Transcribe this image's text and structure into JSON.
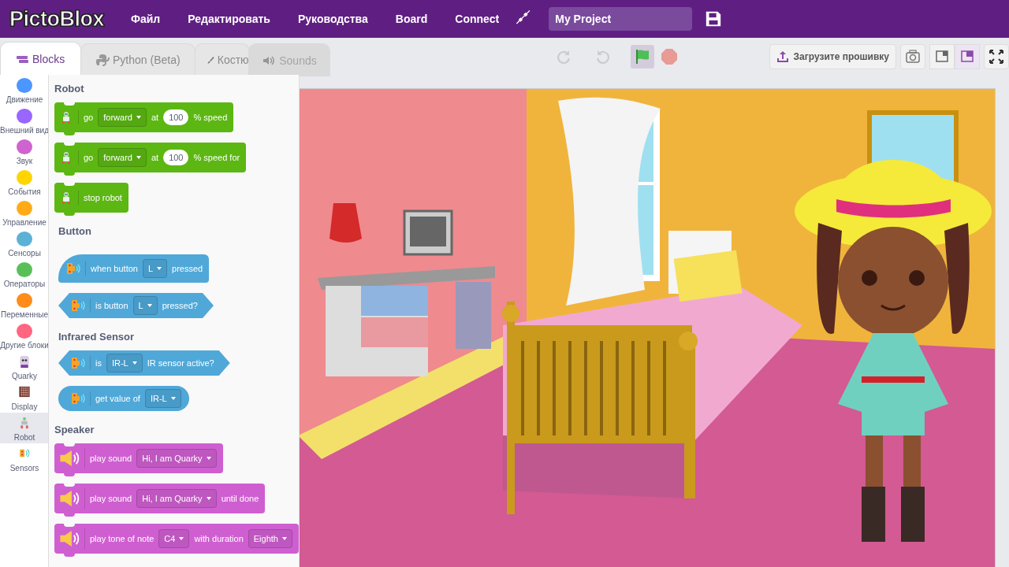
{
  "topbar": {
    "logo": "PictoBlox",
    "menu": [
      "Файл",
      "Редактировать",
      "Руководства",
      "Board",
      "Connect"
    ],
    "project_name": "My Project"
  },
  "tabs": [
    {
      "label": "Blocks",
      "kind": "blocks",
      "selected": true,
      "disabled": false
    },
    {
      "label": "Python (Beta)",
      "kind": "python",
      "selected": false,
      "disabled": false
    },
    {
      "label": "Костю",
      "kind": "brush",
      "selected": false,
      "disabled": false
    },
    {
      "label": "Sounds",
      "kind": "sound",
      "selected": false,
      "disabled": true
    }
  ],
  "categories": [
    {
      "label": "Движение",
      "kind": "dot",
      "color": "#4c97ff",
      "selected": false
    },
    {
      "label": "Внешний вид",
      "kind": "dot",
      "color": "#9966ff",
      "selected": false
    },
    {
      "label": "Звук",
      "kind": "dot",
      "color": "#cf63cf",
      "selected": false
    },
    {
      "label": "События",
      "kind": "dot",
      "color": "#ffd500",
      "selected": false
    },
    {
      "label": "Управление",
      "kind": "dot",
      "color": "#ffab19",
      "selected": false
    },
    {
      "label": "Сенсоры",
      "kind": "dot",
      "color": "#5cb1d6",
      "selected": false
    },
    {
      "label": "Операторы",
      "kind": "dot",
      "color": "#59c059",
      "selected": false
    },
    {
      "label": "Переменные",
      "kind": "dot",
      "color": "#ff8c1a",
      "selected": false
    },
    {
      "label": "Другие блоки",
      "kind": "dot",
      "color": "#ff6680",
      "selected": false
    },
    {
      "label": "Quarky",
      "kind": "quarky",
      "selected": false
    },
    {
      "label": "Display",
      "kind": "display",
      "selected": false
    },
    {
      "label": "Robot",
      "kind": "robot",
      "selected": true
    },
    {
      "label": "Sensors",
      "kind": "sensors",
      "selected": false
    }
  ],
  "palette": [
    {
      "heading": "Robot",
      "kind": "robot",
      "color": "#5cb712",
      "blocks": [
        {
          "kind": "stack",
          "parts": [
            {
              "kind": "text",
              "text": "go"
            },
            {
              "kind": "dropdown",
              "text": "forward"
            },
            {
              "kind": "text",
              "text": "at"
            },
            {
              "kind": "number",
              "text": "100"
            },
            {
              "kind": "text",
              "text": "% speed"
            }
          ]
        },
        {
          "kind": "stack",
          "parts": [
            {
              "kind": "text",
              "text": "go"
            },
            {
              "kind": "dropdown",
              "text": "forward"
            },
            {
              "kind": "text",
              "text": "at"
            },
            {
              "kind": "number",
              "text": "100"
            },
            {
              "kind": "text",
              "text": "% speed for"
            }
          ]
        },
        {
          "kind": "stack",
          "parts": [
            {
              "kind": "text",
              "text": "stop robot"
            }
          ]
        }
      ]
    },
    {
      "heading": "Button",
      "kind": "sensor",
      "color": "#4fa8d8",
      "blocks": [
        {
          "kind": "hat",
          "parts": [
            {
              "kind": "text",
              "text": "when button"
            },
            {
              "kind": "dropdown",
              "text": "L"
            },
            {
              "kind": "text",
              "text": "pressed"
            }
          ]
        },
        {
          "kind": "boolean",
          "parts": [
            {
              "kind": "text",
              "text": "is button"
            },
            {
              "kind": "dropdown",
              "text": "L"
            },
            {
              "kind": "text",
              "text": "pressed?"
            }
          ]
        }
      ]
    },
    {
      "heading": "Infrared Sensor",
      "kind": "sensor",
      "color": "#4fa8d8",
      "blocks": [
        {
          "kind": "boolean",
          "parts": [
            {
              "kind": "text",
              "text": "is"
            },
            {
              "kind": "dropdown",
              "text": "IR-L"
            },
            {
              "kind": "text",
              "text": "IR sensor active?"
            }
          ]
        },
        {
          "kind": "reporter",
          "parts": [
            {
              "kind": "text",
              "text": "get value of"
            },
            {
              "kind": "dropdown",
              "text": "IR-L"
            }
          ]
        }
      ]
    },
    {
      "heading": "Speaker",
      "kind": "speaker",
      "color": "#cf5fd0",
      "blocks": [
        {
          "kind": "stack",
          "parts": [
            {
              "kind": "text",
              "text": "play sound"
            },
            {
              "kind": "dropdown",
              "text": "Hi, I am Quarky"
            }
          ]
        },
        {
          "kind": "stack",
          "parts": [
            {
              "kind": "text",
              "text": "play sound"
            },
            {
              "kind": "dropdown",
              "text": "Hi, I am Quarky"
            },
            {
              "kind": "text",
              "text": "until done"
            }
          ]
        },
        {
          "kind": "stack",
          "parts": [
            {
              "kind": "text",
              "text": "play tone of note"
            },
            {
              "kind": "dropdown",
              "text": "C4"
            },
            {
              "kind": "text",
              "text": "with duration"
            },
            {
              "kind": "dropdown",
              "text": "Eighth"
            }
          ]
        }
      ]
    }
  ],
  "toolbar": {
    "edit_controls": [
      {
        "kind": "redo",
        "disabled": true
      },
      {
        "kind": "undo",
        "disabled": true
      }
    ],
    "run_controls": [
      {
        "kind": "flag",
        "active": true
      },
      {
        "kind": "stop",
        "active": false
      }
    ],
    "upload_button": "Загрузите прошивку",
    "view_controls": [
      {
        "kind": "camera",
        "selected": false
      },
      {
        "kind": "small-stage",
        "selected": false
      },
      {
        "kind": "large-stage",
        "selected": true
      },
      {
        "kind": "fullscreen",
        "selected": false
      }
    ]
  }
}
